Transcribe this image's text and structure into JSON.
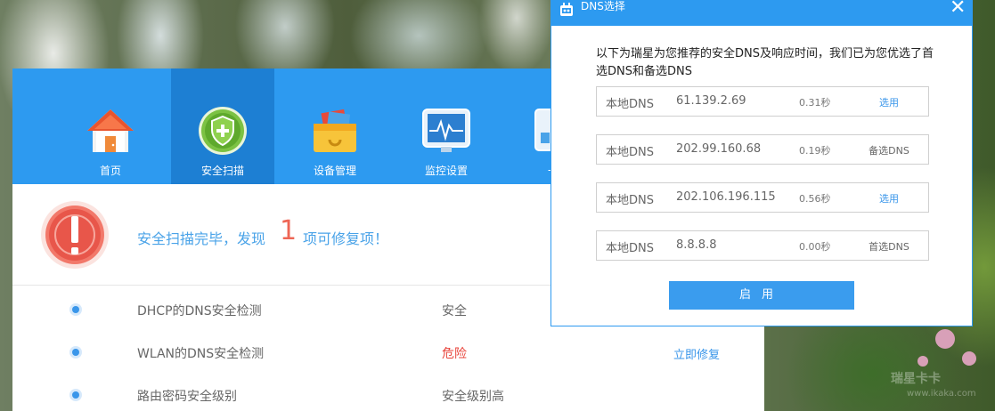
{
  "app": {
    "nav": [
      {
        "label": "首页",
        "icon": "home-icon"
      },
      {
        "label": "安全扫描",
        "icon": "shield-plus-icon",
        "active": true
      },
      {
        "label": "设备管理",
        "icon": "toolbox-icon"
      },
      {
        "label": "监控设置",
        "icon": "monitor-icon"
      },
      {
        "label": "一键",
        "icon": "oneclick-icon"
      }
    ],
    "scan": {
      "prefix": "安全扫描完毕，发现",
      "count": "1",
      "suffix": "项可修复项！",
      "alert_icon": "alert-icon"
    },
    "checks": [
      {
        "name": "DHCP的DNS安全检测",
        "status": "安全",
        "status_color": "#666666",
        "action": ""
      },
      {
        "name": "WLAN的DNS安全检测",
        "status": "危险",
        "status_color": "#e8433a",
        "action": "立即修复"
      },
      {
        "name": "路由密码安全级别",
        "status": "安全级别高",
        "status_color": "#666666",
        "action": ""
      }
    ]
  },
  "dialog": {
    "title": "DNS选择",
    "close": "✕",
    "description": "以下为瑞星为您推荐的安全DNS及响应时间，我们已为您优选了首选DNS和备选DNS",
    "rows": [
      {
        "label": "本地DNS",
        "ip": "61.139.2.69",
        "time": "0.31秒",
        "role": "选用",
        "selectable": true
      },
      {
        "label": "本地DNS",
        "ip": "202.99.160.68",
        "time": "0.19秒",
        "role": "备选DNS",
        "selectable": false
      },
      {
        "label": "本地DNS",
        "ip": "202.106.196.115",
        "time": "0.56秒",
        "role": "选用",
        "selectable": true
      },
      {
        "label": "本地DNS",
        "ip": "8.8.8.8",
        "time": "0.00秒",
        "role": "首选DNS",
        "selectable": false
      }
    ],
    "button": "启用"
  },
  "watermark": {
    "main": "瑞星卡卡",
    "sub": "www.ikaka.com"
  },
  "colors": {
    "accent": "#2d9af0",
    "nav_active": "#1d7fd3",
    "link": "#3a96ea",
    "danger": "#e8433a",
    "count": "#ee6655"
  }
}
